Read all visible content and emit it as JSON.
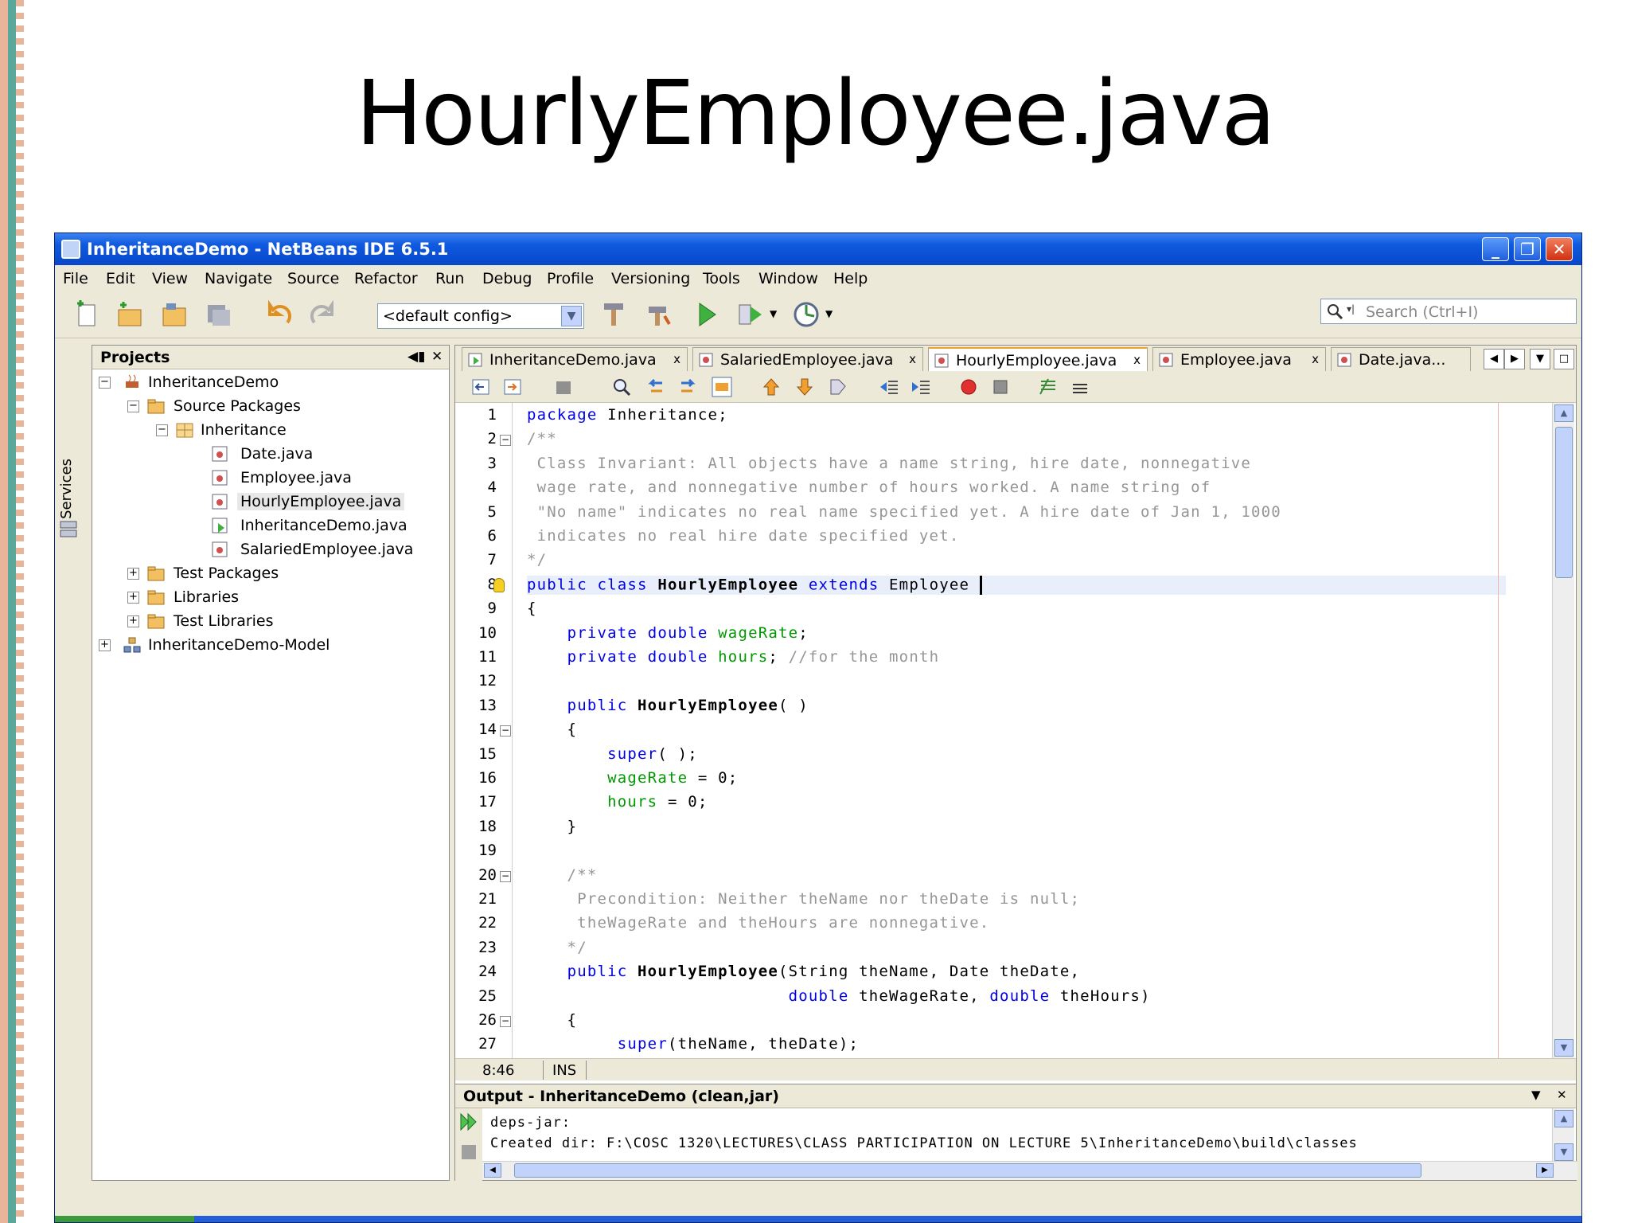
{
  "slide": {
    "title": "HourlyEmployee.java"
  },
  "window": {
    "title": "InheritanceDemo - NetBeans IDE 6.5.1",
    "buttons": {
      "minimize": "_",
      "maximize": "❐",
      "close": "✕"
    }
  },
  "menu": [
    "File",
    "Edit",
    "View",
    "Navigate",
    "Source",
    "Refactor",
    "Run",
    "Debug",
    "Profile",
    "Versioning",
    "Tools",
    "Window",
    "Help"
  ],
  "toolbar": {
    "config": "<default config>",
    "search_placeholder": "Search (Ctrl+I)"
  },
  "services_label": "Services",
  "projects": {
    "title": "Projects",
    "tree": [
      {
        "label": "InheritanceDemo",
        "level": 0,
        "expander": "−",
        "icon": "project-icon"
      },
      {
        "label": "Source Packages",
        "level": 1,
        "expander": "−",
        "icon": "folder-icon"
      },
      {
        "label": "Inheritance",
        "level": 2,
        "expander": "−",
        "icon": "package-icon"
      },
      {
        "label": "Date.java",
        "level": 3,
        "expander": "",
        "icon": "java-file-icon"
      },
      {
        "label": "Employee.java",
        "level": 3,
        "expander": "",
        "icon": "java-file-icon"
      },
      {
        "label": "HourlyEmployee.java",
        "level": 3,
        "expander": "",
        "icon": "java-file-icon",
        "selected": true
      },
      {
        "label": "InheritanceDemo.java",
        "level": 3,
        "expander": "",
        "icon": "java-main-icon"
      },
      {
        "label": "SalariedEmployee.java",
        "level": 3,
        "expander": "",
        "icon": "java-file-icon"
      },
      {
        "label": "Test Packages",
        "level": 1,
        "expander": "+",
        "icon": "folder-icon"
      },
      {
        "label": "Libraries",
        "level": 1,
        "expander": "+",
        "icon": "folder-icon"
      },
      {
        "label": "Test Libraries",
        "level": 1,
        "expander": "+",
        "icon": "folder-icon"
      },
      {
        "label": "InheritanceDemo-Model",
        "level": 0,
        "expander": "+",
        "icon": "uml-project-icon"
      }
    ]
  },
  "tabs": [
    {
      "label": "InheritanceDemo.java",
      "close": "x"
    },
    {
      "label": "SalariedEmployee.java",
      "close": "x"
    },
    {
      "label": "HourlyEmployee.java",
      "close": "x",
      "active": true
    },
    {
      "label": "Employee.java",
      "close": "x"
    },
    {
      "label": "Date.java...",
      "close": ""
    }
  ],
  "code_lines": [
    "package Inheritance;",
    "/**",
    " Class Invariant: All objects have a name string, hire date, nonnegative",
    " wage rate, and nonnegative number of hours worked. A name string of",
    " \"No name\" indicates no real name specified yet. A hire date of Jan 1, 1000",
    " indicates no real hire date specified yet.",
    "*/",
    "public class HourlyEmployee extends Employee ",
    "{",
    "    private double wageRate;",
    "    private double hours; //for the month",
    "",
    "    public HourlyEmployee( )",
    "    {",
    "        super( );",
    "        wageRate = 0;",
    "        hours = 0;",
    "    }",
    "",
    "    /**",
    "     Precondition: Neither theName nor theDate is null;",
    "     theWageRate and theHours are nonnegative.",
    "    */",
    "    public HourlyEmployee(String theName, Date theDate,",
    "                          double theWageRate, double theHours)",
    "    {",
    "         super(theName, theDate);"
  ],
  "status": {
    "position": "8:46",
    "mode": "INS"
  },
  "output": {
    "title": "Output - InheritanceDemo (clean,jar)",
    "lines": [
      "deps-jar:",
      "Created dir: F:\\COSC 1320\\LECTURES\\CLASS PARTICIPATION ON LECTURE 5\\InheritanceDemo\\build\\classes"
    ]
  }
}
